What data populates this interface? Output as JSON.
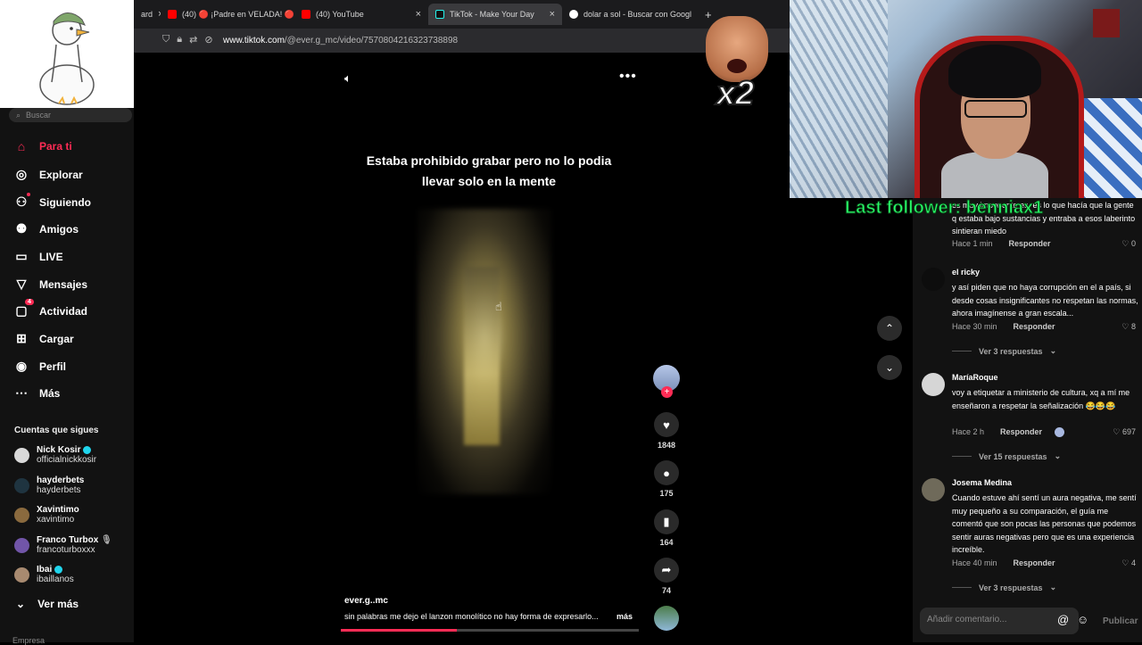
{
  "browser": {
    "tabs": [
      {
        "label": "ard",
        "active": false
      },
      {
        "label": "(40) 🔴 ¡Padre en VELADA! 🔴 ...",
        "active": false
      },
      {
        "label": "(40) YouTube",
        "active": false
      },
      {
        "label": "TikTok - Make Your Day",
        "active": true
      },
      {
        "label": "dolar a sol - Buscar con Google",
        "active": false
      }
    ],
    "new_tab": "+",
    "url_host": "www.tiktok.com",
    "url_path": "/@ever.g_mc/video/7570804216323738898"
  },
  "sidebar": {
    "search_placeholder": "Buscar",
    "items": [
      {
        "label": "Para ti",
        "icon": "home-icon"
      },
      {
        "label": "Explorar",
        "icon": "compass-icon"
      },
      {
        "label": "Siguiendo",
        "icon": "following-icon"
      },
      {
        "label": "Amigos",
        "icon": "friends-icon"
      },
      {
        "label": "LIVE",
        "icon": "live-icon"
      },
      {
        "label": "Mensajes",
        "icon": "messages-icon"
      },
      {
        "label": "Actividad",
        "icon": "activity-icon",
        "badge": "4"
      },
      {
        "label": "Cargar",
        "icon": "upload-icon"
      },
      {
        "label": "Perfil",
        "icon": "profile-icon"
      },
      {
        "label": "Más",
        "icon": "more-icon"
      }
    ],
    "following_title": "Cuentas que sigues",
    "accounts": [
      {
        "name": "Nick Kosir",
        "handle": "officialnickkosir",
        "verified": true
      },
      {
        "name": "hayderbets",
        "handle": "hayderbets",
        "verified": false
      },
      {
        "name": "Xavintimo",
        "handle": "xavintimo",
        "verified": false
      },
      {
        "name": "Franco Turbox",
        "handle": "francoturboxxx",
        "verified": false
      },
      {
        "name": "Ibai",
        "handle": "ibaillanos",
        "verified": true
      }
    ],
    "see_more": "Ver más",
    "footer": "Empresa"
  },
  "video": {
    "caption": "Estaba prohibido grabar pero no lo podia llevar solo en la mente",
    "author": "ever.g..mc",
    "description": "sin palabras me dejo el lanzon monolítico no hay forma de expresarlo...",
    "more": "más",
    "progress": 0.39,
    "likes": "1848",
    "comments": "175",
    "saves": "164",
    "shares": "74"
  },
  "overlays": {
    "multiplier": "x2",
    "last_follower": "Last follower: benniax1"
  },
  "comments": [
    {
      "user": "",
      "text": "es muy imponente es, es lo que hacía que la gente q estaba bajo sustancias y entraba a esos laberinto sintieran miedo",
      "time": "Hace 1 min",
      "reply": "Responder",
      "likes": "0",
      "replies": ""
    },
    {
      "user": "el ricky",
      "text": "y así piden que no haya corrupción en el a país, si desde cosas insignificantes no respetan las normas, ahora imagínense a gran escala...",
      "time": "Hace 30 min",
      "reply": "Responder",
      "likes": "8",
      "replies": "Ver 3 respuestas"
    },
    {
      "user": "MaríaRoque",
      "text": "voy a etiquetar a ministerio de cultura, xq a mí me enseñaron a respetar la señalización 😂😂😂",
      "time": "Hace 2 h",
      "reply": "Responder",
      "likes": "697",
      "replies": "Ver 15 respuestas"
    },
    {
      "user": "Josema Medina",
      "text": "Cuando estuve ahí sentí un aura negativa, me sentí muy pequeño a su comparación, el guía me comentó que son pocas las personas que podemos sentir auras negativas pero que es una experiencia increíble.",
      "time": "Hace 40 min",
      "reply": "Responder",
      "likes": "4",
      "replies": "Ver 3 respuestas"
    }
  ],
  "comment_input": {
    "placeholder": "Añadir comentario...",
    "publish": "Publicar"
  }
}
